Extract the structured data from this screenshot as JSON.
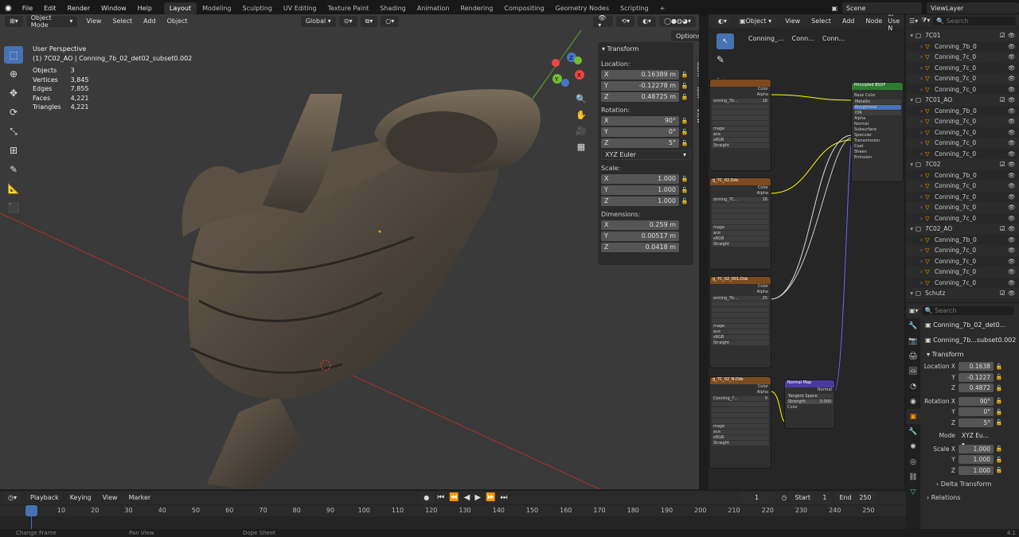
{
  "topbar": {
    "menus": [
      "File",
      "Edit",
      "Render",
      "Window",
      "Help"
    ],
    "workspaces": [
      "Layout",
      "Modeling",
      "Sculpting",
      "UV Editing",
      "Texture Paint",
      "Shading",
      "Animation",
      "Rendering",
      "Compositing",
      "Geometry Nodes",
      "Scripting"
    ],
    "active_workspace": "Layout",
    "add_tab": "+",
    "scene": "Scene",
    "view_layer": "ViewLayer"
  },
  "viewport": {
    "mode": "Object Mode",
    "menus": [
      "View",
      "Select",
      "Add",
      "Object"
    ],
    "orientation": "Global",
    "options": "Options",
    "perspective": "User Perspective",
    "object_label": "(1) 7C02_AO | Conning_7b_02_det02_subset0.002",
    "stats": [
      [
        "Objects",
        "3"
      ],
      [
        "Vertices",
        "3,845"
      ],
      [
        "Edges",
        "7,855"
      ],
      [
        "Faces",
        "4,221"
      ],
      [
        "Triangles",
        "4,221"
      ]
    ],
    "gizmo": {
      "x": "X",
      "y": "Y",
      "z": "Z"
    }
  },
  "npanel": {
    "title": "Transform",
    "location_label": "Location:",
    "location": [
      [
        "X",
        "0.16389 m"
      ],
      [
        "Y",
        "-0.12278 m"
      ],
      [
        "Z",
        "0.48725 m"
      ]
    ],
    "rotation_label": "Rotation:",
    "rotation": [
      [
        "X",
        "90°"
      ],
      [
        "Y",
        "0°"
      ],
      [
        "Z",
        "5°"
      ]
    ],
    "rotation_mode": "XYZ Euler",
    "scale_label": "Scale:",
    "scale": [
      [
        "X",
        "1.000"
      ],
      [
        "Y",
        "1.000"
      ],
      [
        "Z",
        "1.000"
      ]
    ],
    "dimensions_label": "Dimensions:",
    "dimensions": [
      [
        "X",
        "0.259 m"
      ],
      [
        "Y",
        "0.00517 m"
      ],
      [
        "Z",
        "0.0418 m"
      ]
    ],
    "tabs": [
      "Item",
      "Tool",
      "View"
    ]
  },
  "nodeeditor": {
    "type": "Object",
    "menus": [
      "View",
      "Select",
      "Add",
      "Node"
    ],
    "use_nodes": "Use N",
    "breadcrumbs": [
      "Conning_...",
      "Conn...",
      "Conn..."
    ],
    "bsdf": {
      "title": "Principled BSDF",
      "rows": [
        "Base Color",
        "Metallic",
        "Roughness",
        "IOR",
        "Alpha",
        "Normal",
        "Subsurface",
        "Specular",
        "Transmission",
        "Coat",
        "Sheen",
        "Emission"
      ]
    },
    "normalmap": {
      "title": "Normal Map",
      "out": "Normal",
      "space": "Tangent Space",
      "strength": "Strength",
      "strength_val": "0.000",
      "in": "Color"
    },
    "tex_nodes": [
      {
        "title": "",
        "name": "onning_7b...",
        "num": "18",
        "out": [
          "Color",
          "Alpha"
        ]
      },
      {
        "title": "g_7C_02.Dds",
        "name": "onning_7C...",
        "num": "18",
        "out": [
          "Color",
          "Alpha"
        ]
      },
      {
        "title": "g_7C_02_001.Dds",
        "name": "onning_7b...",
        "num": "25",
        "out": [
          "Color",
          "Alpha"
        ]
      },
      {
        "title": "g_7C_02_N.Dds",
        "name": "Conning_7...",
        "num": "9",
        "out": [
          "Color",
          "Alpha"
        ]
      }
    ],
    "tex_fields": [
      "mage",
      "ace",
      "sRGB",
      "Straight"
    ]
  },
  "outliner": {
    "search": "Search",
    "rows": [
      {
        "t": "c",
        "name": "7C01"
      },
      {
        "t": "o",
        "name": "Conning_7b_0"
      },
      {
        "t": "o",
        "name": "Conning_7c_0"
      },
      {
        "t": "o",
        "name": "Conning_7c_0"
      },
      {
        "t": "o",
        "name": "Conning_7c_0"
      },
      {
        "t": "o",
        "name": "Conning_7c_0"
      },
      {
        "t": "c",
        "name": "7C01_AO"
      },
      {
        "t": "o",
        "name": "Conning_7b_0"
      },
      {
        "t": "o",
        "name": "Conning_7c_0"
      },
      {
        "t": "o",
        "name": "Conning_7c_0"
      },
      {
        "t": "o",
        "name": "Conning_7c_0"
      },
      {
        "t": "o",
        "name": "Conning_7c_0"
      },
      {
        "t": "c",
        "name": "7C02"
      },
      {
        "t": "o",
        "name": "Conning_7b_0"
      },
      {
        "t": "o",
        "name": "Conning_7c_0"
      },
      {
        "t": "o",
        "name": "Conning_7c_0"
      },
      {
        "t": "o",
        "name": "Conning_7c_0"
      },
      {
        "t": "o",
        "name": "Conning_7c_0"
      },
      {
        "t": "c",
        "name": "7C02_AO"
      },
      {
        "t": "o",
        "name": "Conning_7b_0"
      },
      {
        "t": "o",
        "name": "Conning_7c_0"
      },
      {
        "t": "o",
        "name": "Conning_7c_0"
      },
      {
        "t": "o",
        "name": "Conning_7c_0"
      },
      {
        "t": "o",
        "name": "Conning_7c_0"
      },
      {
        "t": "c",
        "name": "Schutz"
      }
    ]
  },
  "props": {
    "search": "Search",
    "object": "Conning_7b_02_det0...",
    "mesh": "Conning_7b...subset0.002",
    "transform": "Transform",
    "location": [
      [
        "Location X",
        "0.1638"
      ],
      [
        "Y",
        "-0.1227"
      ],
      [
        "Z",
        "0.4872"
      ]
    ],
    "rotation": [
      [
        "Rotation X",
        "90°"
      ],
      [
        "Y",
        "0°"
      ],
      [
        "Z",
        "5°"
      ]
    ],
    "mode_label": "Mode",
    "mode": "XYZ Eu...",
    "scale": [
      [
        "Scale X",
        "1.000"
      ],
      [
        "Y",
        "1.000"
      ],
      [
        "Z",
        "1.000"
      ]
    ],
    "delta": "Delta Transform",
    "relations": "Relations"
  },
  "timeline": {
    "menus": [
      "Playback",
      "Keying",
      "View",
      "Marker"
    ],
    "frame": "1",
    "start_label": "Start",
    "start": "1",
    "end_label": "End",
    "end": "250",
    "ticks": [
      "1",
      "10",
      "20",
      "30",
      "40",
      "50",
      "60",
      "70",
      "80",
      "90",
      "100",
      "110",
      "120",
      "130",
      "140",
      "150",
      "160",
      "170",
      "180",
      "190",
      "200",
      "210",
      "220",
      "230",
      "240",
      "250"
    ]
  },
  "status": {
    "items": [
      "Change Frame",
      "Pan View",
      "Dope Sheet"
    ],
    "version": "4.1"
  }
}
